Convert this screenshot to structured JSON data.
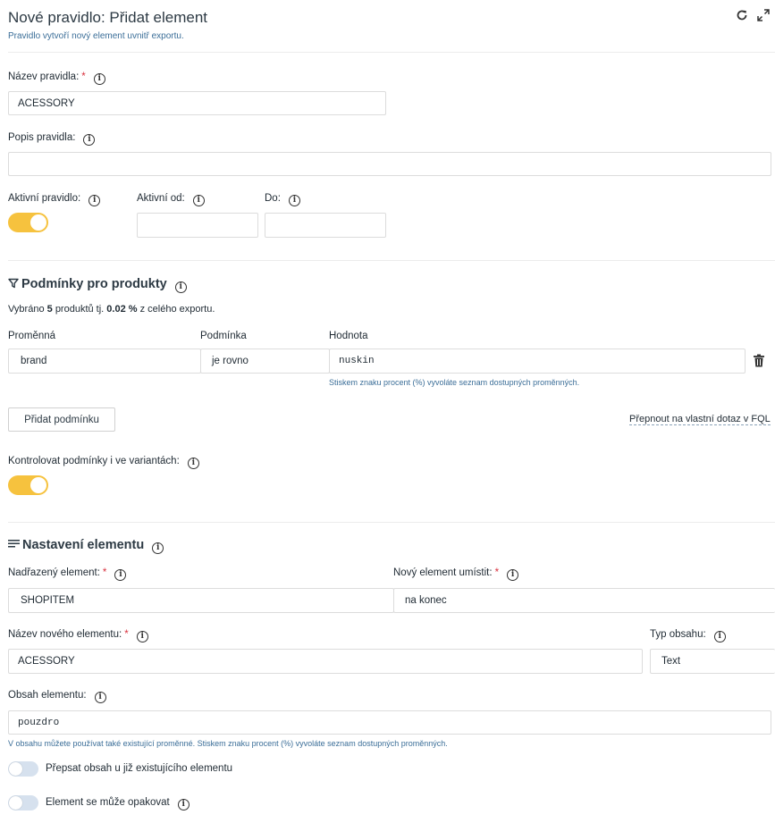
{
  "header": {
    "title": "Nové pravidlo: Přidat element",
    "subtitle": "Pravidlo vytvoří nový element uvnitř exportu.",
    "refresh_icon": "refresh-icon",
    "expand_icon": "expand-icon"
  },
  "rule": {
    "name_label": "Název pravidla:",
    "name_value": "ACESSORY",
    "description_label": "Popis pravidla:",
    "description_value": "",
    "active_label": "Aktivní pravidlo:",
    "active": true,
    "active_from_label": "Aktivní od:",
    "active_from_value": "",
    "active_to_label": "Do:",
    "active_to_value": "",
    "required_mark": "*",
    "info_glyph": "i"
  },
  "conditions": {
    "title": "Podmínky pro produkty",
    "icon": "filter-icon",
    "summary_prefix": "Vybráno",
    "summary_count": "5",
    "summary_mid": "produktů tj.",
    "summary_percent": "0.02 %",
    "summary_suffix": "z celého exportu.",
    "col_variable": "Proměnná",
    "col_condition": "Podmínka",
    "col_value": "Hodnota",
    "rows": [
      {
        "variable": "brand",
        "condition": "je rovno",
        "value": "nuskin"
      }
    ],
    "value_hint": "Stiskem znaku procent (%) vyvoláte seznam dostupných proměnných.",
    "add_button": "Přidat podmínku",
    "fql_link": "Přepnout na vlastní dotaz v FQL",
    "check_variants_label": "Kontrolovat podmínky i ve variantách:",
    "check_variants": true
  },
  "element": {
    "title": "Nastavení elementu",
    "icon": "lines-icon",
    "parent_label": "Nadřazený element:",
    "parent_value": "SHOPITEM",
    "placement_label": "Nový element umístit:",
    "placement_value": "na konec",
    "name_label": "Název nového elementu:",
    "name_value": "ACESSORY",
    "content_type_label": "Typ obsahu:",
    "content_type_value": "Text",
    "content_label": "Obsah elementu:",
    "content_value": "pouzdro",
    "content_hint": "V obsahu můžete používat také existující proměnné. Stiskem znaku procent (%) vyvoláte seznam dostupných proměnných.",
    "overwrite_label": "Přepsat obsah u již existujícího elementu",
    "overwrite": false,
    "repeat_label": "Element se může opakovat",
    "repeat": false
  },
  "colors": {
    "accent_toggle": "#f6c23e",
    "hint_text": "#3b6e98",
    "required": "#d9323f"
  }
}
